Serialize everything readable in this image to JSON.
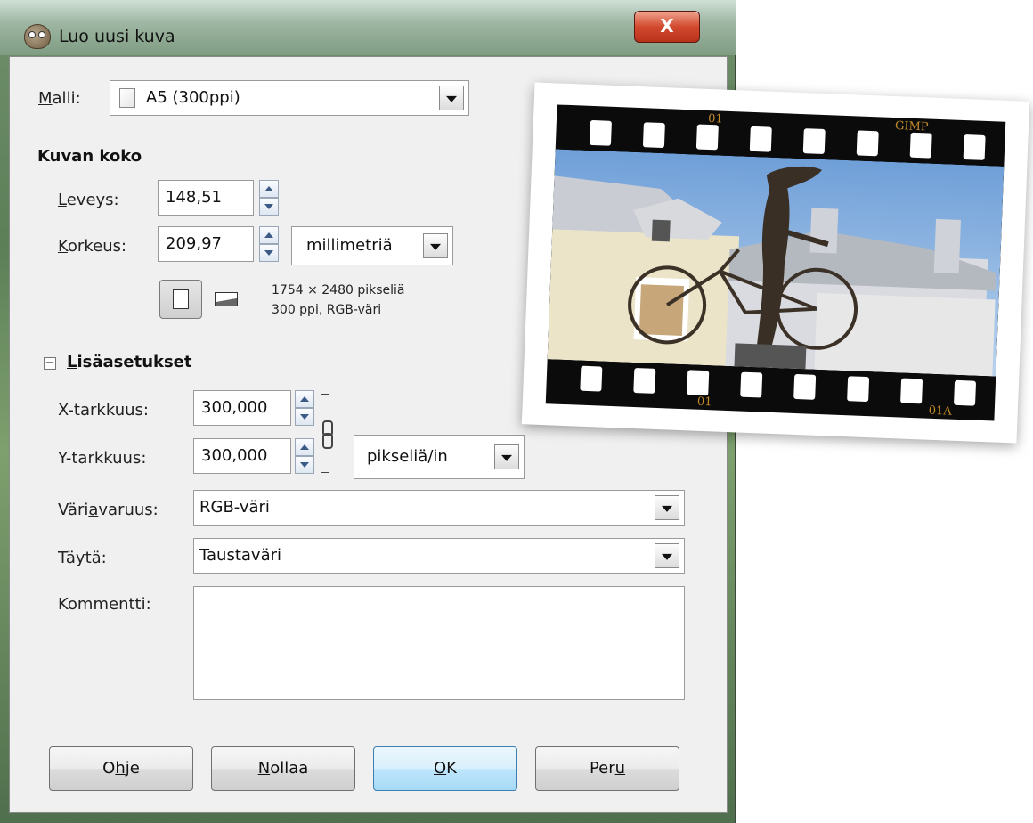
{
  "window": {
    "title": "Luo uusi kuva",
    "close_label": "X"
  },
  "template": {
    "label_prefix": "M",
    "label_rest": "alli:",
    "value": "A5 (300ppi)"
  },
  "image_size": {
    "heading": "Kuvan koko",
    "width_label_prefix": "L",
    "width_label_rest": "eveys:",
    "width_value": "148,51",
    "height_label_prefix": "K",
    "height_label_rest": "orkeus:",
    "height_value": "209,97",
    "unit": "millimetriä",
    "info_line1": "1754 × 2480 pikseliä",
    "info_line2": "300 ppi, RGB-väri"
  },
  "advanced": {
    "toggle_symbol": "−",
    "heading_prefix": "L",
    "heading_rest": "isäasetukset",
    "x_res_label": "X-tarkkuus:",
    "x_res_value": "300,000",
    "y_res_label": "Y-tarkkuus:",
    "y_res_value": "300,000",
    "res_unit": "pikseliä/in",
    "colorspace_label_a": "Väri",
    "colorspace_label_u": "a",
    "colorspace_label_b": "varuus:",
    "colorspace_value": "RGB-väri",
    "fill_label": "Täytä:",
    "fill_value": "Taustaväri",
    "comment_label": "Kommentti:",
    "comment_value": ""
  },
  "buttons": {
    "help_a": "O",
    "help_u": "h",
    "help_b": "je",
    "reset_u": "N",
    "reset_b": "ollaa",
    "ok_u": "O",
    "ok_b": "K",
    "cancel_a": "Per",
    "cancel_u": "u"
  },
  "photo": {
    "num_top_left": "01",
    "num_top_right": "GIMP",
    "num_bottom_left": "01",
    "num_bottom_right": "01A"
  },
  "colors": {
    "dialog_bg": "#f0f0f0",
    "ok_button": "#bee6fd",
    "close_button": "#d24a2e"
  }
}
